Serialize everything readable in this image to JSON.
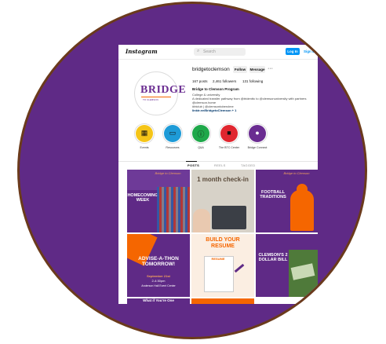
{
  "topbar": {
    "logo": "Instagram",
    "search_placeholder": "Search",
    "login_label": "Log In",
    "signup_label": "Sign Up"
  },
  "profile": {
    "brand_logo": "BRIDGE",
    "brand_sub": "TO CLEMSON",
    "username": "bridgetoclemson",
    "follow_label": "Follow",
    "message_label": "Message",
    "more_label": "···",
    "stats": [
      "167 posts",
      "2,461 followers",
      "131 following"
    ],
    "display_name": "Bridge to Clemson Program",
    "category": "College & university",
    "bio_line1": "A dedicated transfer pathway from @tridenttc to @clemsonuniversity with partners",
    "bio_line2": "@clemson.home",
    "bio_line3": "#btclub | @clemsontoberclme",
    "link_text": "linktr.ee/BridgetoClemson + 1"
  },
  "highlights": [
    {
      "label": "Events",
      "icon": "calendar-icon",
      "color": "#f5c518",
      "glyph": "▦"
    },
    {
      "label": "Resources",
      "icon": "book-icon",
      "color": "#1e9bd7",
      "glyph": "▭"
    },
    {
      "label": "Q&A",
      "icon": "info-icon",
      "color": "#1fa84a",
      "glyph": "ⓘ"
    },
    {
      "label": "The BTC Center",
      "icon": "chat-icon",
      "color": "#e0262f",
      "glyph": "■"
    },
    {
      "label": "Bridge Connect",
      "icon": "person-icon",
      "color": "#6a2c91",
      "glyph": "●"
    }
  ],
  "tabs": {
    "posts": "POSTS",
    "reels": "REELS",
    "tagged": "TAGGED"
  },
  "posts": [
    {
      "text": "HOMECOMING WEEK",
      "corner": "Bridge to Clemson"
    },
    {
      "text": "1 month check-in"
    },
    {
      "text": "FOOTBALL TRADITIONS",
      "corner": "Bridge to Clemson"
    },
    {
      "text": "ADVISE-A-THON TOMORROW!",
      "sub": "September 21st",
      "sub2": "2-4:30pm",
      "sub3": "Anderson Hall Event Center"
    },
    {
      "text": "BUILD YOUR RESUME",
      "badge": "RESUME"
    },
    {
      "text": "CLEMSON'S 2 DOLLAR BILL"
    },
    {
      "text": "What if You're One"
    }
  ],
  "colors": {
    "purple": "#5f2a86",
    "orange": "#f56600",
    "blue": "#0095f6"
  }
}
